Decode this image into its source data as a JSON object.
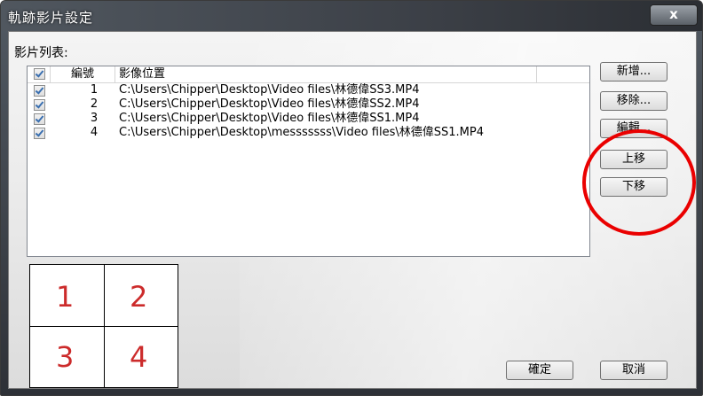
{
  "window": {
    "title": "軌跡影片設定",
    "close_glyph": "x"
  },
  "list": {
    "label": "影片列表:",
    "headers": {
      "number": "編號",
      "location": "影像位置"
    },
    "rows": [
      {
        "number": "1",
        "path": "C:\\Users\\Chipper\\Desktop\\Video files\\林德偉SS3.MP4"
      },
      {
        "number": "2",
        "path": "C:\\Users\\Chipper\\Desktop\\Video files\\林德偉SS2.MP4"
      },
      {
        "number": "3",
        "path": "C:\\Users\\Chipper\\Desktop\\Video files\\林德偉SS1.MP4"
      },
      {
        "number": "4",
        "path": "C:\\Users\\Chipper\\Desktop\\messsssss\\Video files\\林德偉SS1.MP4"
      }
    ]
  },
  "buttons": {
    "add": "新增...",
    "remove": "移除...",
    "edit": "編輯...",
    "move_up": "上移",
    "move_down": "下移",
    "ok": "確定",
    "cancel": "取消"
  },
  "layout_grid": {
    "cells": [
      "1",
      "2",
      "3",
      "4"
    ],
    "color": "#cc2b2b"
  },
  "annotation": {
    "color": "#ea0000"
  }
}
